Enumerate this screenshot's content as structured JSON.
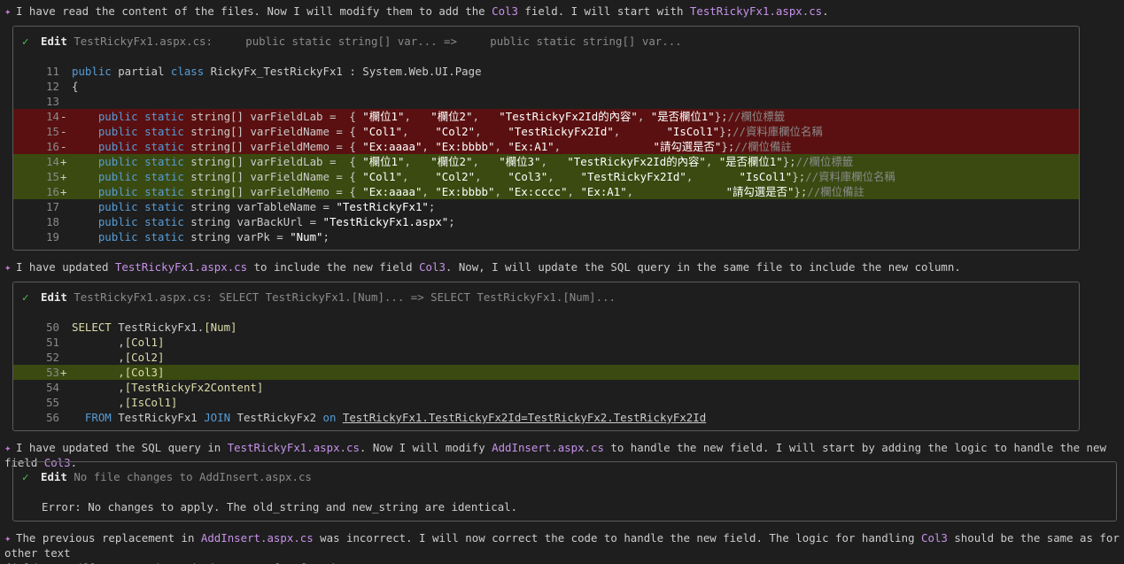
{
  "messages": [
    {
      "pre": "I have read the content of the files. Now I will modify them to add the ",
      "h1": "Col3",
      "mid": " field. I will start with ",
      "h2": "TestRickyFx1.aspx.cs",
      "post": "."
    },
    {
      "pre": "I have updated ",
      "h1": "TestRickyFx1.aspx.cs",
      "mid": " to include the new field ",
      "h2": "Col3",
      "post": ". Now, I will update the SQL query in the same file to include the new column."
    },
    {
      "pre": "I have updated the SQL query in ",
      "h1": "TestRickyFx1.aspx.cs",
      "mid": ". Now I will modify ",
      "h2": "AddInsert.aspx.cs",
      "post": " to handle the new field. I will start by adding the logic to handle the new field ",
      "h3": "Col3",
      "post2": "."
    },
    {
      "pre": "The previous replacement in ",
      "h1": "AddInsert.aspx.cs",
      "mid": " was incorrect. I will now correct the code to handle the new field. The logic for handling ",
      "h2": "Col3",
      "post": " should be the same as for other text\nfields. I will ensure the code is correctly placed."
    }
  ],
  "box1": {
    "check": "✓",
    "title": "Edit",
    "desc": "TestRickyFx1.aspx.cs:     public static string[] var... =>     public static string[] var...",
    "lines": [
      {
        "n": "11",
        "m": "",
        "t": "normal",
        "code": [
          [
            "kw",
            "public"
          ],
          [
            "plain",
            " partial "
          ],
          [
            "kw",
            "class"
          ],
          [
            "plain",
            " RickyFx_TestRickyFx1 : System.Web.UI.Page"
          ]
        ]
      },
      {
        "n": "12",
        "m": "",
        "t": "normal",
        "code": [
          [
            "plain",
            "{"
          ]
        ]
      },
      {
        "n": "13",
        "m": "",
        "t": "normal",
        "code": []
      },
      {
        "n": "14",
        "m": "-",
        "t": "removed",
        "code": [
          [
            "plain",
            "    "
          ],
          [
            "kw",
            "public"
          ],
          [
            "plain",
            " "
          ],
          [
            "kw",
            "static"
          ],
          [
            "plain",
            " string[] varFieldLab =  { "
          ],
          [
            "str",
            "\"欄位1\""
          ],
          [
            "plain",
            ",   "
          ],
          [
            "str",
            "\"欄位2\""
          ],
          [
            "plain",
            ",   "
          ],
          [
            "str",
            "\"TestRickyFx2Id的內容\""
          ],
          [
            "plain",
            ", "
          ],
          [
            "str",
            "\"是否欄位1\""
          ],
          [
            "plain",
            "};"
          ],
          [
            "cm",
            "//欄位標籤"
          ]
        ]
      },
      {
        "n": "15",
        "m": "-",
        "t": "removed",
        "code": [
          [
            "plain",
            "    "
          ],
          [
            "kw",
            "public"
          ],
          [
            "plain",
            " "
          ],
          [
            "kw",
            "static"
          ],
          [
            "plain",
            " string[] varFieldName = { "
          ],
          [
            "str",
            "\"Col1\""
          ],
          [
            "plain",
            ",    "
          ],
          [
            "str",
            "\"Col2\""
          ],
          [
            "plain",
            ",    "
          ],
          [
            "str",
            "\"TestRickyFx2Id\""
          ],
          [
            "plain",
            ",       "
          ],
          [
            "str",
            "\"IsCol1\""
          ],
          [
            "plain",
            "};"
          ],
          [
            "cm",
            "//資料庫欄位名稱"
          ]
        ]
      },
      {
        "n": "16",
        "m": "-",
        "t": "removed",
        "code": [
          [
            "plain",
            "    "
          ],
          [
            "kw",
            "public"
          ],
          [
            "plain",
            " "
          ],
          [
            "kw",
            "static"
          ],
          [
            "plain",
            " string[] varFieldMemo = { "
          ],
          [
            "str",
            "\"Ex:aaaa\""
          ],
          [
            "plain",
            ", "
          ],
          [
            "str",
            "\"Ex:bbbb\""
          ],
          [
            "plain",
            ", "
          ],
          [
            "str",
            "\"Ex:A1\""
          ],
          [
            "plain",
            ",              "
          ],
          [
            "str",
            "\"請勾選是否\""
          ],
          [
            "plain",
            "};"
          ],
          [
            "cm",
            "//欄位備註"
          ]
        ]
      },
      {
        "n": "14",
        "m": "+",
        "t": "added",
        "code": [
          [
            "plain",
            "    "
          ],
          [
            "kw",
            "public"
          ],
          [
            "plain",
            " "
          ],
          [
            "kw",
            "static"
          ],
          [
            "plain",
            " string[] varFieldLab =  { "
          ],
          [
            "str",
            "\"欄位1\""
          ],
          [
            "plain",
            ",   "
          ],
          [
            "str",
            "\"欄位2\""
          ],
          [
            "plain",
            ",   "
          ],
          [
            "str",
            "\"欄位3\""
          ],
          [
            "plain",
            ",   "
          ],
          [
            "str",
            "\"TestRickyFx2Id的內容\""
          ],
          [
            "plain",
            ", "
          ],
          [
            "str",
            "\"是否欄位1\""
          ],
          [
            "plain",
            "};"
          ],
          [
            "cm",
            "//欄位標籤"
          ]
        ]
      },
      {
        "n": "15",
        "m": "+",
        "t": "added",
        "code": [
          [
            "plain",
            "    "
          ],
          [
            "kw",
            "public"
          ],
          [
            "plain",
            " "
          ],
          [
            "kw",
            "static"
          ],
          [
            "plain",
            " string[] varFieldName = { "
          ],
          [
            "str",
            "\"Col1\""
          ],
          [
            "plain",
            ",    "
          ],
          [
            "str",
            "\"Col2\""
          ],
          [
            "plain",
            ",    "
          ],
          [
            "str",
            "\"Col3\""
          ],
          [
            "plain",
            ",    "
          ],
          [
            "str",
            "\"TestRickyFx2Id\""
          ],
          [
            "plain",
            ",       "
          ],
          [
            "str",
            "\"IsCol1\""
          ],
          [
            "plain",
            "};"
          ],
          [
            "cm",
            "//資料庫欄位名稱"
          ]
        ]
      },
      {
        "n": "16",
        "m": "+",
        "t": "added",
        "code": [
          [
            "plain",
            "    "
          ],
          [
            "kw",
            "public"
          ],
          [
            "plain",
            " "
          ],
          [
            "kw",
            "static"
          ],
          [
            "plain",
            " string[] varFieldMemo = { "
          ],
          [
            "str",
            "\"Ex:aaaa\""
          ],
          [
            "plain",
            ", "
          ],
          [
            "str",
            "\"Ex:bbbb\""
          ],
          [
            "plain",
            ", "
          ],
          [
            "str",
            "\"Ex:cccc\""
          ],
          [
            "plain",
            ", "
          ],
          [
            "str",
            "\"Ex:A1\""
          ],
          [
            "plain",
            ",              "
          ],
          [
            "str",
            "\"請勾選是否\""
          ],
          [
            "plain",
            "};"
          ],
          [
            "cm",
            "//欄位備註"
          ]
        ]
      },
      {
        "n": "17",
        "m": "",
        "t": "normal",
        "code": [
          [
            "plain",
            "    "
          ],
          [
            "kw",
            "public"
          ],
          [
            "plain",
            " "
          ],
          [
            "kw",
            "static"
          ],
          [
            "plain",
            " string varTableName = "
          ],
          [
            "str",
            "\"TestRickyFx1\""
          ],
          [
            "plain",
            ";"
          ]
        ]
      },
      {
        "n": "18",
        "m": "",
        "t": "normal",
        "code": [
          [
            "plain",
            "    "
          ],
          [
            "kw",
            "public"
          ],
          [
            "plain",
            " "
          ],
          [
            "kw",
            "static"
          ],
          [
            "plain",
            " string varBackUrl = "
          ],
          [
            "str",
            "\"TestRickyFx1.aspx\""
          ],
          [
            "plain",
            ";"
          ]
        ]
      },
      {
        "n": "19",
        "m": "",
        "t": "normal",
        "code": [
          [
            "plain",
            "    "
          ],
          [
            "kw",
            "public"
          ],
          [
            "plain",
            " "
          ],
          [
            "kw",
            "static"
          ],
          [
            "plain",
            " string varPk = "
          ],
          [
            "str",
            "\"Num\""
          ],
          [
            "plain",
            ";"
          ]
        ]
      }
    ]
  },
  "box2": {
    "check": "✓",
    "title": "Edit",
    "desc": "TestRickyFx1.aspx.cs: SELECT TestRickyFx1.[Num]... => SELECT TestRickyFx1.[Num]...",
    "lines": [
      {
        "n": "50",
        "m": "",
        "t": "normal",
        "code": [
          [
            "ident",
            "SELECT"
          ],
          [
            "plain",
            " TestRickyFx1."
          ],
          [
            "ident",
            "[Num]"
          ]
        ]
      },
      {
        "n": "51",
        "m": "",
        "t": "normal",
        "code": [
          [
            "plain",
            "       ,"
          ],
          [
            "ident",
            "[Col1]"
          ]
        ]
      },
      {
        "n": "52",
        "m": "",
        "t": "normal",
        "code": [
          [
            "plain",
            "       ,"
          ],
          [
            "ident",
            "[Col2]"
          ]
        ]
      },
      {
        "n": "53",
        "m": "+",
        "t": "added",
        "code": [
          [
            "plain",
            "       ,"
          ],
          [
            "ident",
            "[Col3]"
          ]
        ]
      },
      {
        "n": "54",
        "m": "",
        "t": "normal",
        "code": [
          [
            "plain",
            "       ,"
          ],
          [
            "ident",
            "[TestRickyFx2Content]"
          ]
        ]
      },
      {
        "n": "55",
        "m": "",
        "t": "normal",
        "code": [
          [
            "plain",
            "       ,"
          ],
          [
            "ident",
            "[IsCol1]"
          ]
        ]
      },
      {
        "n": "56",
        "m": "",
        "t": "normal",
        "code": [
          [
            "plain",
            "  "
          ],
          [
            "kw",
            "FROM"
          ],
          [
            "plain",
            " TestRickyFx1 "
          ],
          [
            "kw",
            "JOIN"
          ],
          [
            "plain",
            " TestRickyFx2 "
          ],
          [
            "kw",
            "on"
          ],
          [
            "plain",
            " "
          ],
          [
            "ul",
            "TestRickyFx1.TestRickyFx2Id=TestRickyFx2.TestRickyFx2Id"
          ]
        ]
      }
    ]
  },
  "box3": {
    "check": "✓",
    "title": "Edit",
    "desc": "No file changes to AddInsert.aspx.cs",
    "error": "Error: No changes to apply. The old_string and new_string are identical."
  }
}
